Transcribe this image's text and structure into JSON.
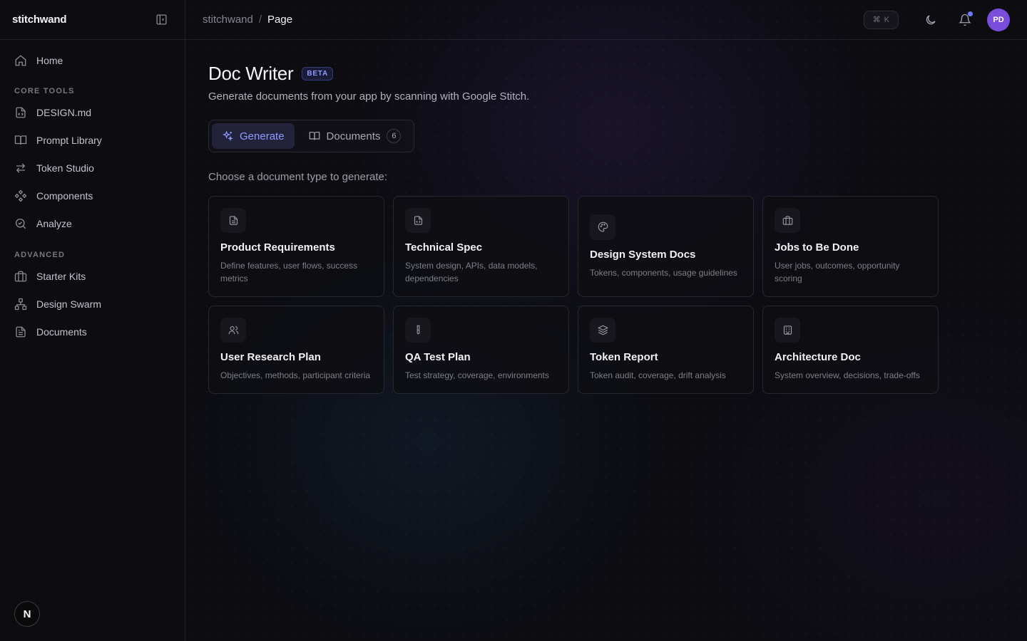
{
  "sidebar": {
    "brand": "stitchwand",
    "items_top": [
      {
        "label": "Home",
        "icon": "home-icon"
      }
    ],
    "sections": [
      {
        "title": "CORE TOOLS",
        "items": [
          {
            "label": "DESIGN.md",
            "icon": "file-code-icon"
          },
          {
            "label": "Prompt Library",
            "icon": "book-icon"
          },
          {
            "label": "Token Studio",
            "icon": "arrows-swap-icon"
          },
          {
            "label": "Components",
            "icon": "components-icon"
          },
          {
            "label": "Analyze",
            "icon": "search-check-icon"
          }
        ]
      },
      {
        "title": "ADVANCED",
        "items": [
          {
            "label": "Starter Kits",
            "icon": "briefcase-icon"
          },
          {
            "label": "Design Swarm",
            "icon": "network-icon"
          },
          {
            "label": "Documents",
            "icon": "document-icon"
          }
        ]
      }
    ],
    "footer_logo": "N"
  },
  "topbar": {
    "breadcrumb_root": "stitchwand",
    "breadcrumb_separator": "/",
    "breadcrumb_current": "Page",
    "shortcut_symbol": "⌘",
    "shortcut_key": "K",
    "avatar_initials": "PD"
  },
  "page": {
    "title": "Doc Writer",
    "badge": "BETA",
    "subtitle": "Generate documents from your app by scanning with Google Stitch.",
    "tabs": [
      {
        "label": "Generate",
        "icon": "sparkles-icon",
        "active": true
      },
      {
        "label": "Documents",
        "icon": "open-book-icon",
        "count": "6"
      }
    ],
    "prompt": "Choose a document type to generate:"
  },
  "cards": [
    {
      "title": "Product Requirements",
      "desc": "Define features, user flows, success metrics",
      "icon": "file-text-icon"
    },
    {
      "title": "Technical Spec",
      "desc": "System design, APIs, data models, dependencies",
      "icon": "file-code-icon"
    },
    {
      "title": "Design System Docs",
      "desc": "Tokens, components, usage guidelines",
      "icon": "palette-icon"
    },
    {
      "title": "Jobs to Be Done",
      "desc": "User jobs, outcomes, opportunity scoring",
      "icon": "briefcase-icon"
    },
    {
      "title": "User Research Plan",
      "desc": "Objectives, methods, participant criteria",
      "icon": "users-icon"
    },
    {
      "title": "QA Test Plan",
      "desc": "Test strategy, coverage, environments",
      "icon": "test-tube-icon"
    },
    {
      "title": "Token Report",
      "desc": "Token audit, coverage, drift analysis",
      "icon": "layers-icon"
    },
    {
      "title": "Architecture Doc",
      "desc": "System overview, decisions, trade-offs",
      "icon": "building-icon"
    }
  ],
  "colors": {
    "accent": "#8f9bff",
    "avatar": "#7b4ddb",
    "notification_dot": "#6d7cff"
  }
}
